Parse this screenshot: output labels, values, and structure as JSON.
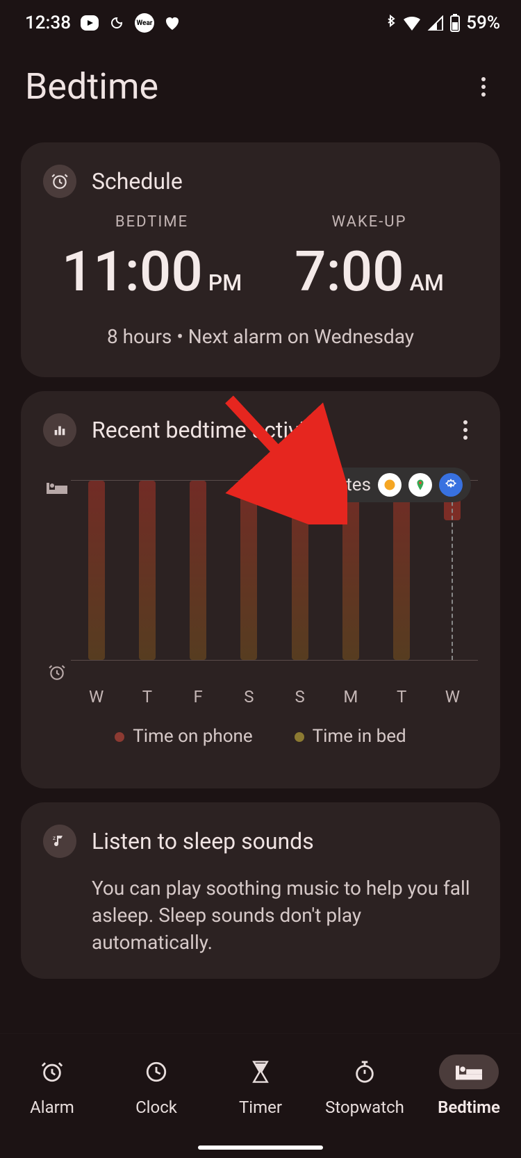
{
  "status": {
    "time": "12:38",
    "battery": "59%",
    "icons": {
      "wear_label": "Wear"
    }
  },
  "header": {
    "title": "Bedtime"
  },
  "schedule": {
    "title": "Schedule",
    "bedtime_label": "BEDTIME",
    "wakeup_label": "WAKE-UP",
    "bedtime_time": "11:00",
    "bedtime_ampm": "PM",
    "wakeup_time": "7:00",
    "wakeup_ampm": "AM",
    "note": "8 hours • Next alarm on Wednesday"
  },
  "activity": {
    "title": "Recent bedtime activity",
    "tooltip_text": "2 minutes",
    "days": [
      "W",
      "T",
      "F",
      "S",
      "S",
      "M",
      "T",
      "W"
    ],
    "legend_phone": "Time on phone",
    "legend_bed": "Time in bed"
  },
  "sounds": {
    "title": "Listen to sleep sounds",
    "desc": "You can play soothing music to help you fall asleep. Sleep sounds don't play automatically."
  },
  "nav": {
    "alarm": "Alarm",
    "clock": "Clock",
    "timer": "Timer",
    "stopwatch": "Stopwatch",
    "bedtime": "Bedtime"
  },
  "chart_data": {
    "type": "bar",
    "title": "Recent bedtime activity",
    "categories": [
      "W",
      "T",
      "F",
      "S",
      "S",
      "M",
      "T",
      "W"
    ],
    "series": [
      {
        "name": "Time on phone",
        "values": [
          1,
          1,
          1,
          1,
          1,
          1,
          1,
          0.3
        ]
      },
      {
        "name": "Time in bed",
        "values": [
          0,
          0,
          0,
          0,
          0,
          0,
          0,
          0
        ]
      }
    ],
    "y_axis": {
      "top_label": "bed-icon",
      "bottom_label": "alarm-icon"
    },
    "tooltip": {
      "day_index": 7,
      "text": "2 minutes"
    }
  }
}
